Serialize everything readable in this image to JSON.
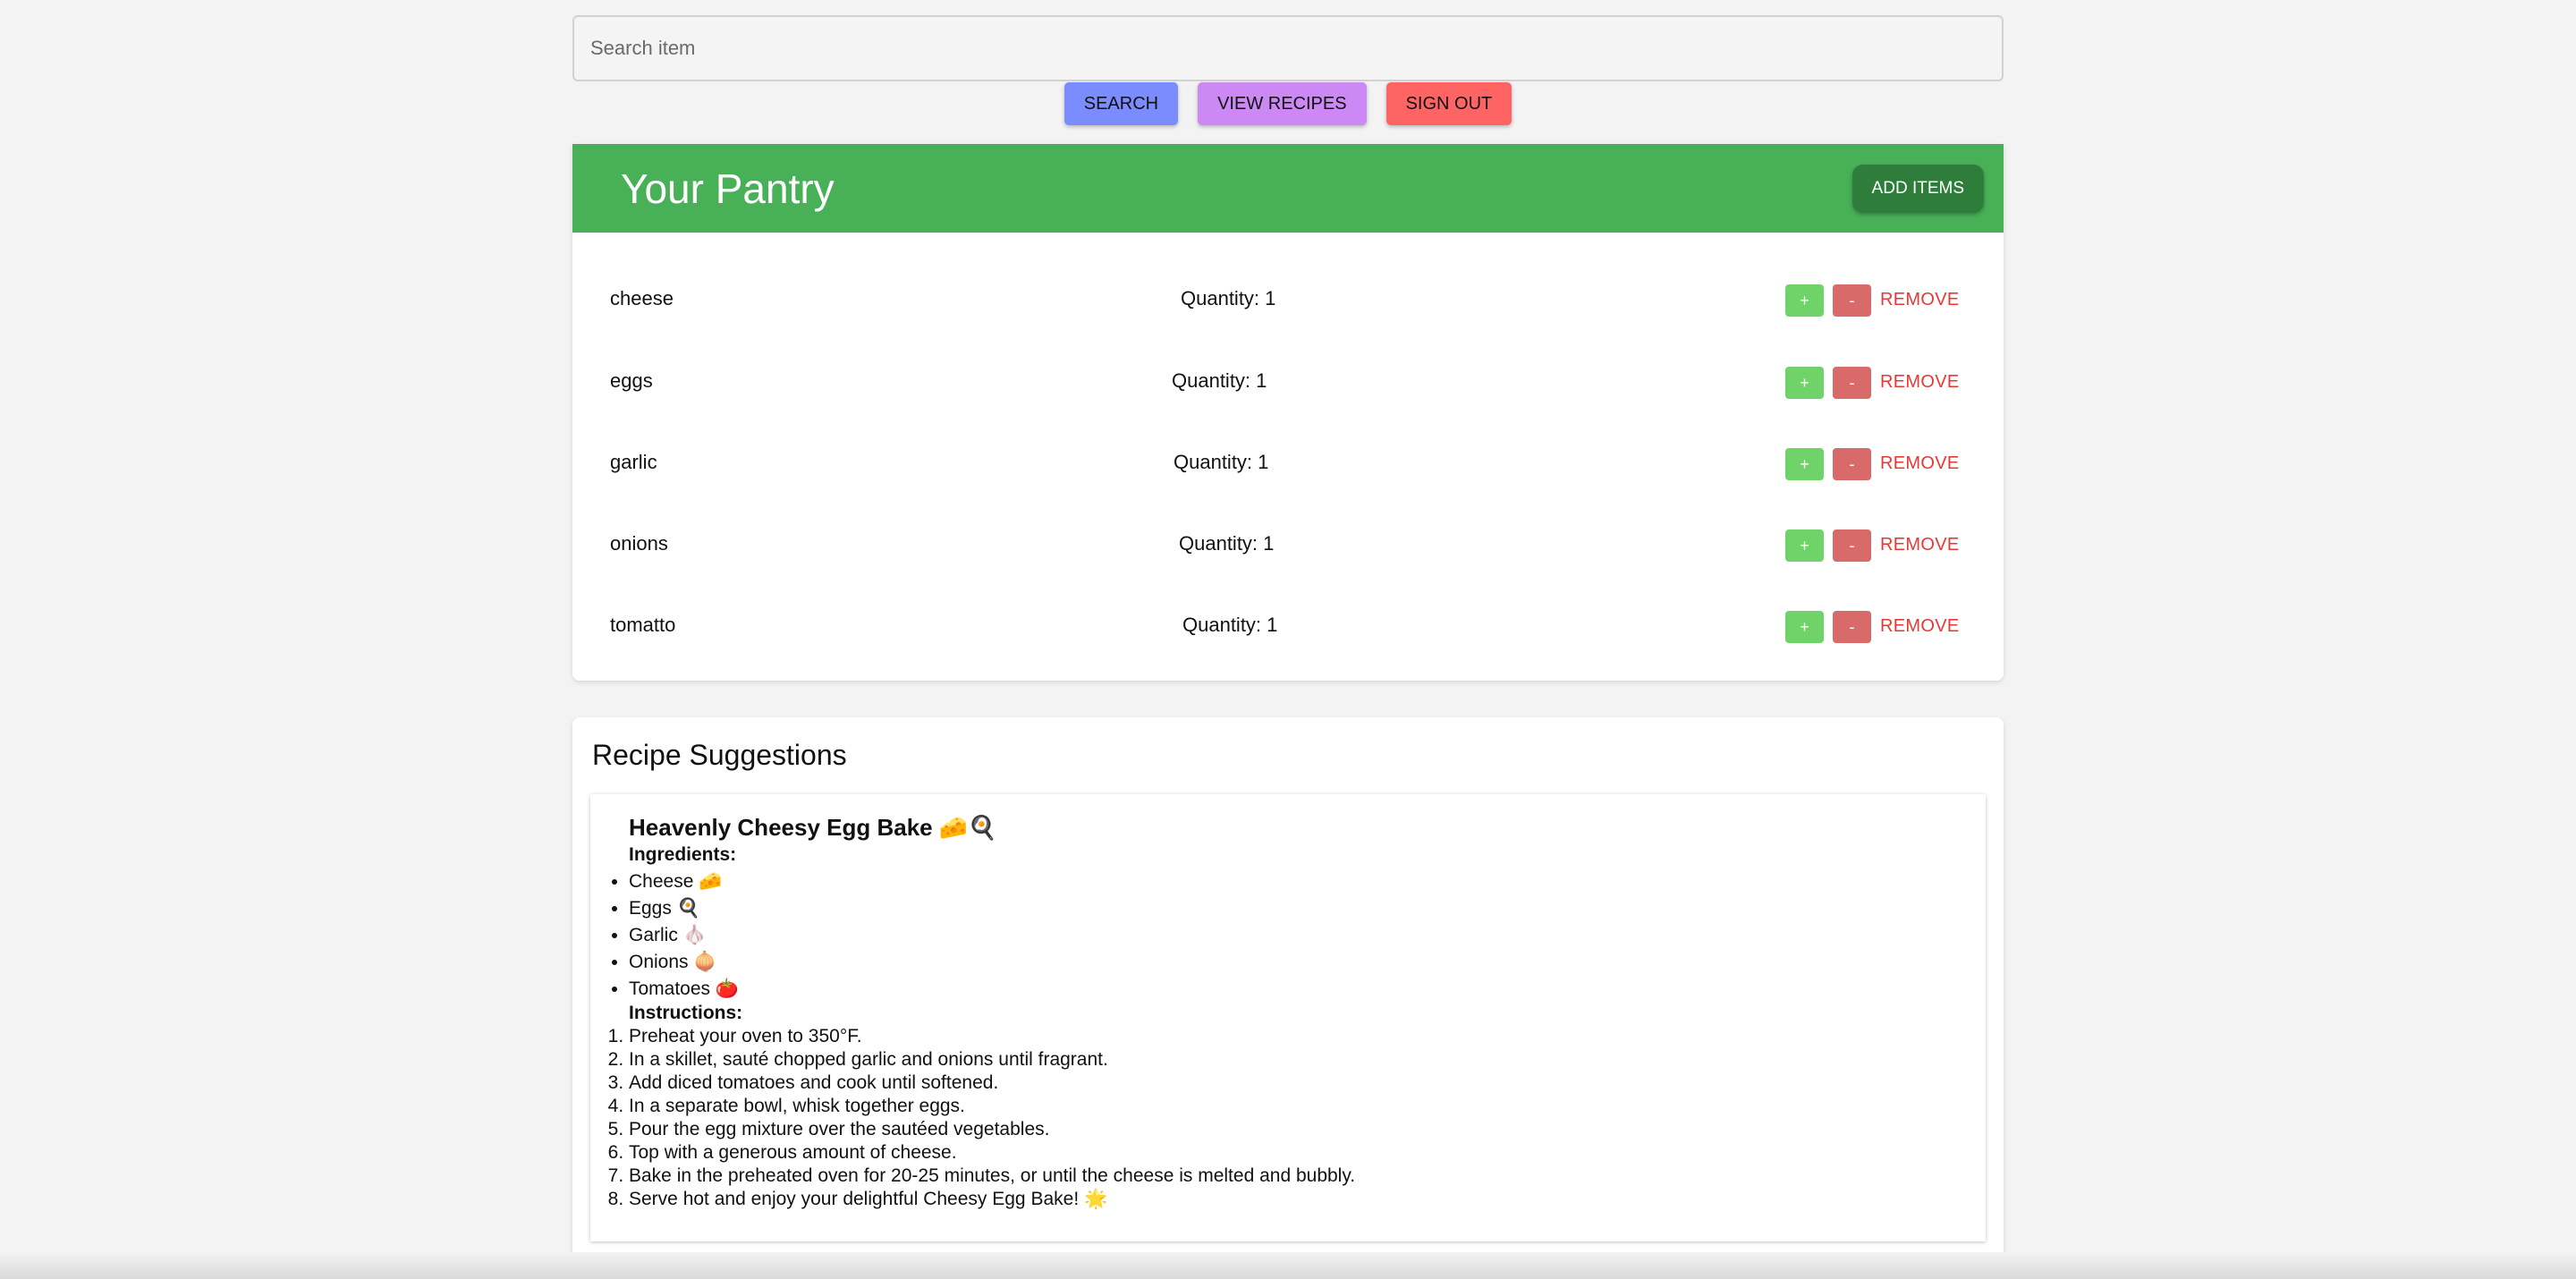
{
  "search": {
    "placeholder": "Search item"
  },
  "toolbar": {
    "search_label": "SEARCH",
    "view_recipes_label": "VIEW RECIPES",
    "sign_out_label": "SIGN OUT"
  },
  "pantry": {
    "title": "Your Pantry",
    "add_label": "ADD ITEMS",
    "items": [
      {
        "name": "cheese",
        "quantity": "Quantity: 1"
      },
      {
        "name": "eggs",
        "quantity": "Quantity: 1"
      },
      {
        "name": "garlic",
        "quantity": "Quantity: 1"
      },
      {
        "name": "onions",
        "quantity": "Quantity: 1"
      },
      {
        "name": "tomatto",
        "quantity": "Quantity: 1"
      }
    ],
    "plus_label": "+",
    "minus_label": "-",
    "remove_label": "REMOVE"
  },
  "recipes": {
    "title": "Recipe Suggestions",
    "recipe": {
      "name": "Heavenly Cheesy Egg Bake 🧀🍳",
      "ingredients_label": "Ingredients:",
      "ingredients": [
        "Cheese 🧀",
        "Eggs 🍳",
        "Garlic 🧄",
        "Onions 🧅",
        "Tomatoes 🍅"
      ],
      "instructions_label": "Instructions:",
      "steps": [
        "Preheat your oven to 350°F.",
        "In a skillet, sauté chopped garlic and onions until fragrant.",
        "Add diced tomatoes and cook until softened.",
        "In a separate bowl, whisk together eggs.",
        "Pour the egg mixture over the sautéed vegetables.",
        "Top with a generous amount of cheese.",
        "Bake in the preheated oven for 20-25 minutes, or until the cheese is melted and bubbly.",
        "Serve hot and enjoy your delightful Cheesy Egg Bake! 🌟"
      ]
    }
  },
  "colors": {
    "header_green": "#48b158",
    "add_button": "#2e7d3a",
    "search_button": "#7b8cff",
    "recipes_button": "#cc88f5",
    "signout_button": "#ff6464",
    "plus_button": "#6fd36a",
    "minus_button": "#d96a6a",
    "remove_text": "#e53935"
  }
}
